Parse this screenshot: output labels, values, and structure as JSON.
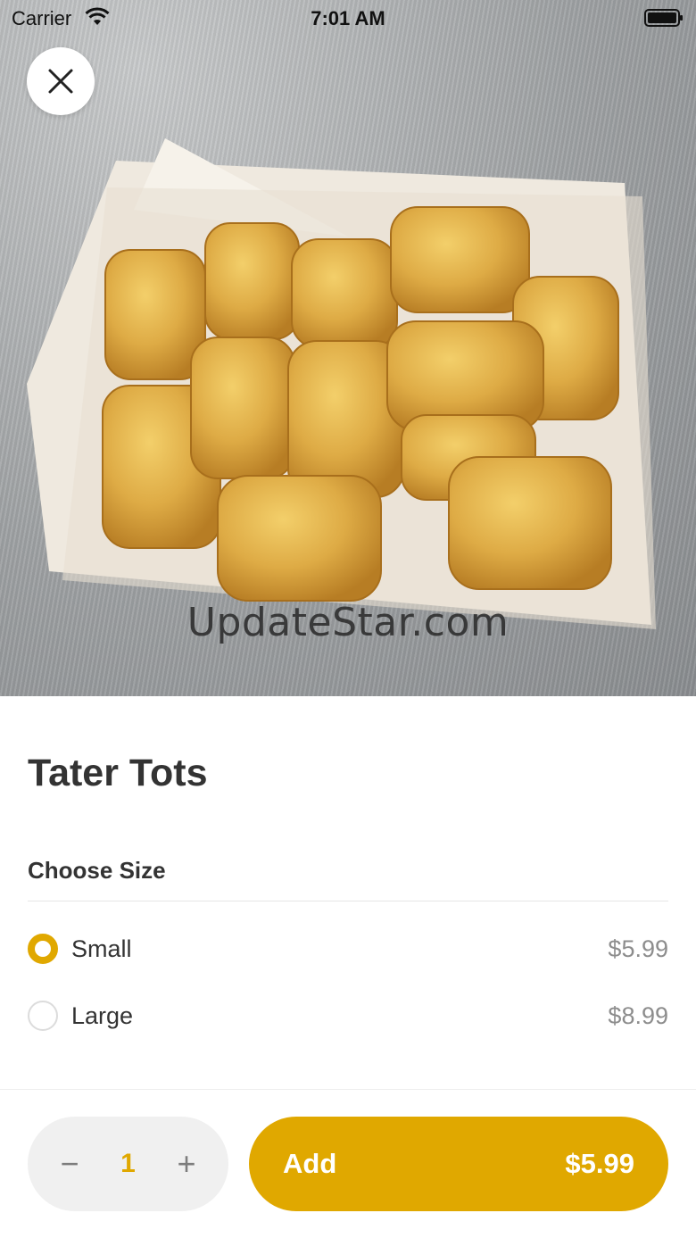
{
  "status_bar": {
    "carrier": "Carrier",
    "time": "7:01 AM"
  },
  "hero": {
    "watermark": "UpdateStar.com"
  },
  "item": {
    "title": "Tater Tots"
  },
  "size_section": {
    "title": "Choose Size",
    "options": [
      {
        "label": "Small",
        "price": "$5.99",
        "selected": true
      },
      {
        "label": "Large",
        "price": "$8.99",
        "selected": false
      }
    ]
  },
  "stepper": {
    "minus": "−",
    "quantity": "1",
    "plus": "+"
  },
  "add_button": {
    "label": "Add",
    "price": "$5.99"
  },
  "colors": {
    "accent": "#e0a800",
    "stepper_bg": "#f0f0f0",
    "price_text": "#8d8d8d",
    "title_text": "#333333"
  },
  "icons": {
    "close": "close-icon",
    "wifi": "wifi-icon",
    "battery": "battery-icon"
  }
}
